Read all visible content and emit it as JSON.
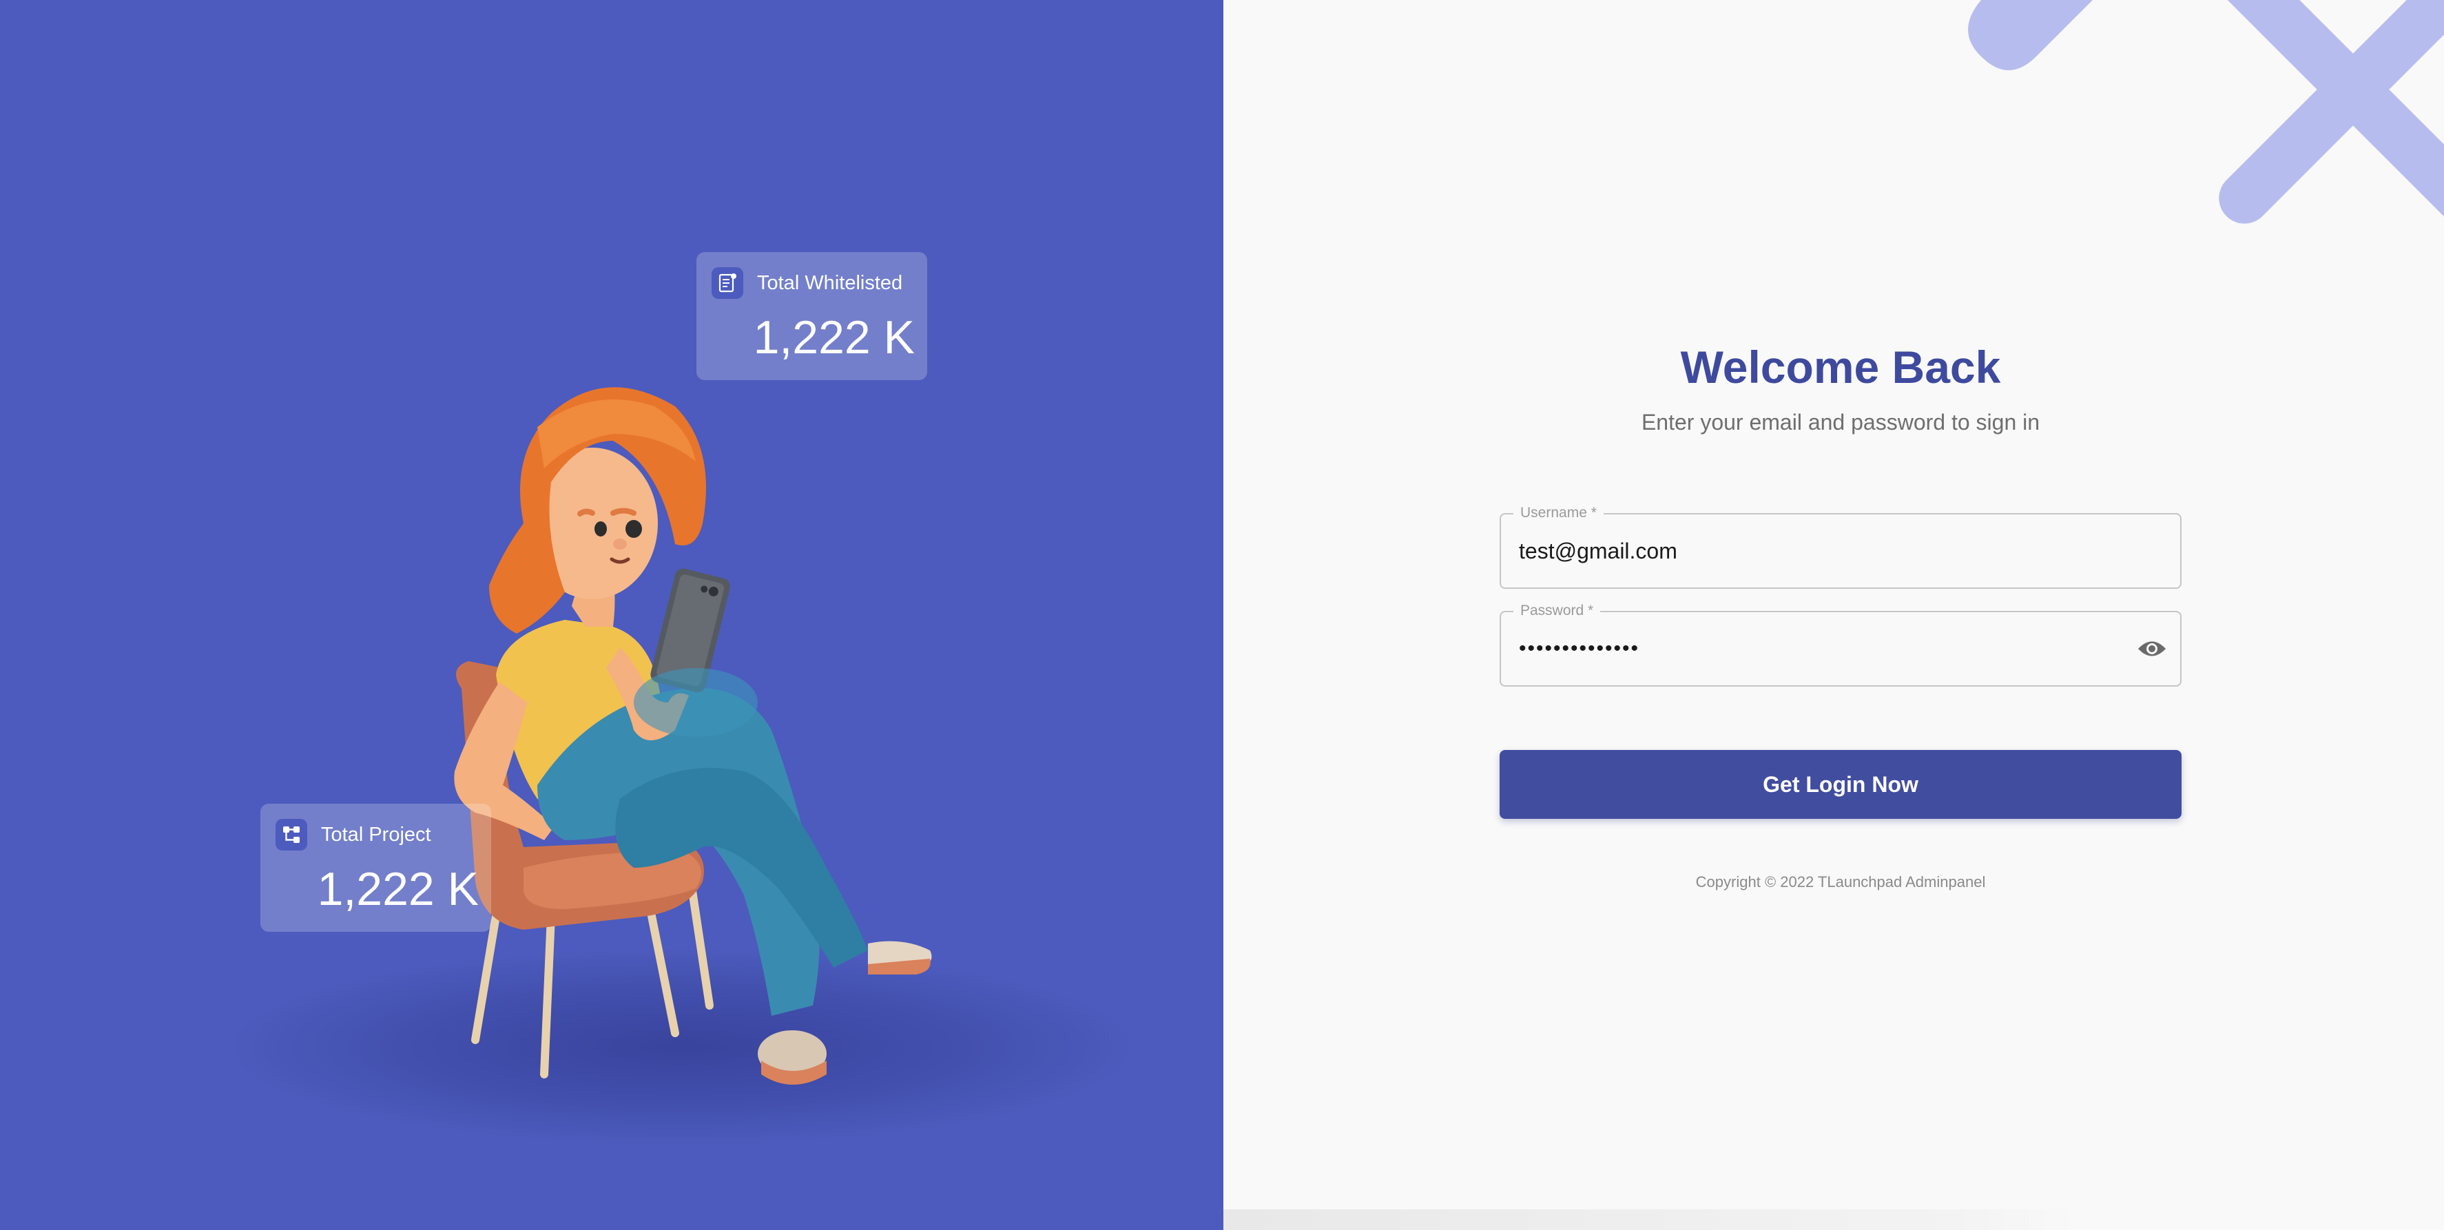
{
  "stats": {
    "whitelisted": {
      "label": "Total Whitelisted",
      "value": "1,222 K",
      "icon": "document-icon"
    },
    "project": {
      "label": "Total Project",
      "value": "1,222 K",
      "icon": "project-tree-icon"
    }
  },
  "login": {
    "title": "Welcome Back",
    "subtitle": "Enter your email and password to sign in",
    "username": {
      "label": "Username *",
      "value": "test@gmail.com"
    },
    "password": {
      "label": "Password *",
      "masked_value": "••••••••••••••",
      "toggle_icon": "eye-icon"
    },
    "submit_label": "Get Login Now",
    "copyright": "Copyright © 2022 TLaunchpad Adminpanel"
  },
  "colors": {
    "left_background": "#4c5bbd",
    "right_background": "#f9f9f9",
    "accent": "#414d9f",
    "title": "#3e4a9e",
    "decoration": "#b6bdee"
  }
}
